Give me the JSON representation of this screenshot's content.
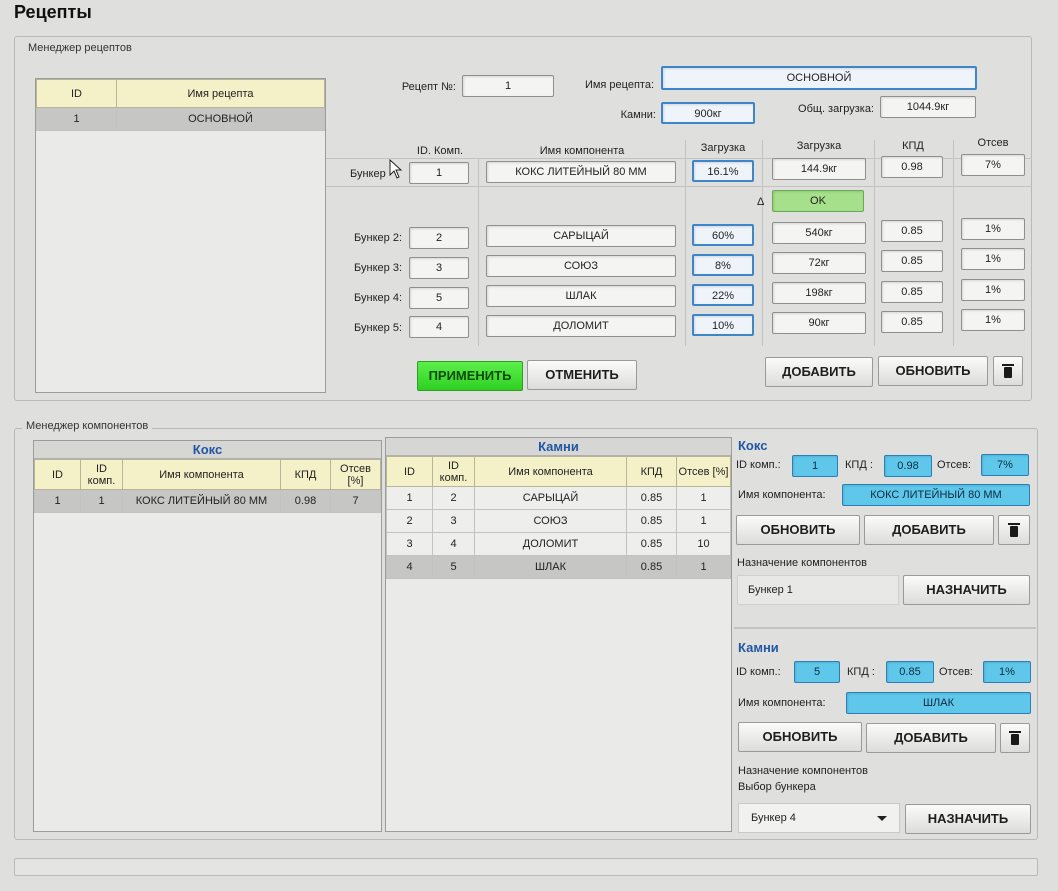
{
  "title": "Рецепты",
  "recipe_manager": {
    "group_title": "Менеджер рецептов",
    "list": {
      "headers": {
        "id": "ID",
        "name": "Имя рецепта"
      },
      "rows": [
        {
          "id": "1",
          "name": "ОСНОВНОЙ"
        }
      ]
    },
    "recipe_no_label": "Рецепт №:",
    "recipe_no": "1",
    "recipe_name_label": "Имя рецепта:",
    "recipe_name": "ОСНОВНОЙ",
    "stones_label": "Камни:",
    "stones": "900кг",
    "total_label": "Общ. загрузка:",
    "total": "1044.9кг",
    "columns": {
      "id_comp": "ID. Комп.",
      "comp_name": "Имя компонента",
      "load_pct": "Загрузка",
      "load_kg": "Загрузка",
      "kpd": "КПД",
      "sieve": "Отсев"
    },
    "bunker1": {
      "label": "Бункер",
      "id": "1",
      "name": "КОКС ЛИТЕЙНЫЙ 80 ММ",
      "pct": "16.1%",
      "kg": "144.9кг",
      "kpd": "0.98",
      "sieve": "7%"
    },
    "delta_label": "Δ",
    "status": "OK",
    "bunkers": [
      {
        "label": "Бункер 2:",
        "id": "2",
        "name": "САРЫЦАЙ",
        "pct": "60%",
        "kg": "540кг",
        "kpd": "0.85",
        "sieve": "1%"
      },
      {
        "label": "Бункер 3:",
        "id": "3",
        "name": "СОЮЗ",
        "pct": "8%",
        "kg": "72кг",
        "kpd": "0.85",
        "sieve": "1%"
      },
      {
        "label": "Бункер 4:",
        "id": "5",
        "name": "ШЛАК",
        "pct": "22%",
        "kg": "198кг",
        "kpd": "0.85",
        "sieve": "1%"
      },
      {
        "label": "Бункер 5:",
        "id": "4",
        "name": "ДОЛОМИТ",
        "pct": "10%",
        "kg": "90кг",
        "kpd": "0.85",
        "sieve": "1%"
      }
    ],
    "buttons": {
      "apply": "ПРИМЕНИТЬ",
      "cancel": "ОТМЕНИТЬ",
      "add": "ДОБАВИТЬ",
      "update": "ОБНОВИТЬ"
    }
  },
  "component_manager": {
    "group_title": "Менеджер компонентов",
    "coke_table": {
      "title": "Кокс",
      "headers": {
        "id": "ID",
        "id_comp": "ID комп.",
        "name": "Имя компонента",
        "kpd": "КПД",
        "sieve": "Отсев [%]"
      },
      "rows": [
        {
          "id": "1",
          "id_comp": "1",
          "name": "КОКС ЛИТЕЙНЫЙ 80 ММ",
          "kpd": "0.98",
          "sieve": "7"
        }
      ]
    },
    "stones_table": {
      "title": "Камни",
      "headers": {
        "id": "ID",
        "id_comp": "ID комп.",
        "name": "Имя компонента",
        "kpd": "КПД",
        "sieve": "Отсев [%]"
      },
      "rows": [
        {
          "id": "1",
          "id_comp": "2",
          "name": "САРЫЦАЙ",
          "kpd": "0.85",
          "sieve": "1"
        },
        {
          "id": "2",
          "id_comp": "3",
          "name": "СОЮЗ",
          "kpd": "0.85",
          "sieve": "1"
        },
        {
          "id": "3",
          "id_comp": "4",
          "name": "ДОЛОМИТ",
          "kpd": "0.85",
          "sieve": "10"
        },
        {
          "id": "4",
          "id_comp": "5",
          "name": "ШЛАК",
          "kpd": "0.85",
          "sieve": "1"
        }
      ]
    },
    "coke_edit": {
      "title": "Кокс",
      "id_label": "ID комп.:",
      "id": "1",
      "kpd_label": "КПД :",
      "kpd": "0.98",
      "sieve_label": "Отсев:",
      "sieve": "7%",
      "name_label": "Имя компонента:",
      "name": "КОКС ЛИТЕЙНЫЙ 80 ММ",
      "update": "ОБНОВИТЬ",
      "add": "ДОБАВИТЬ",
      "assign_title": "Назначение компонентов",
      "assign_value": "Бункер 1",
      "assign_button": "НАЗНАЧИТЬ"
    },
    "stones_edit": {
      "title": "Камни",
      "id_label": "ID комп.:",
      "id": "5",
      "kpd_label": "КПД :",
      "kpd": "0.85",
      "sieve_label": "Отсев:",
      "sieve": "1%",
      "name_label": "Имя компонента:",
      "name": "ШЛАК",
      "update": "ОБНОВИТЬ",
      "add": "ДОБАВИТЬ",
      "assign_title": "Назначение компонентов",
      "bunker_select_label": "Выбор бункера",
      "bunker_selected": "Бункер 4",
      "assign_button": "НАЗНАЧИТЬ"
    }
  }
}
